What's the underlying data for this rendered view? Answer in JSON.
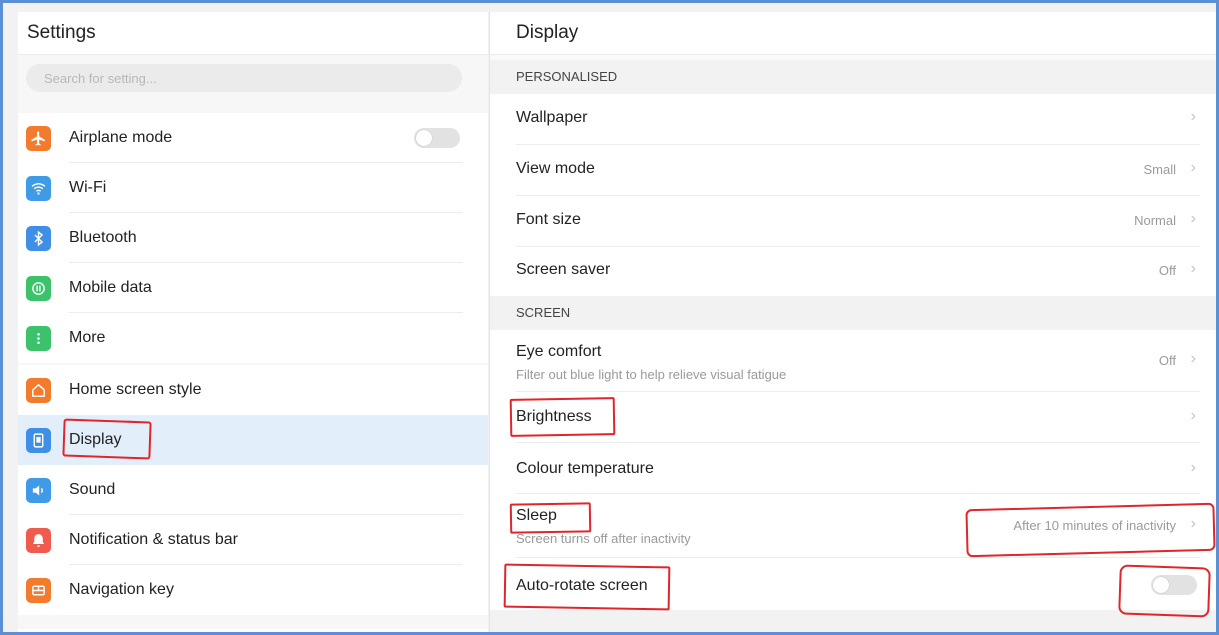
{
  "left_title": "Settings",
  "search_placeholder": "Search for setting...",
  "left_items": [
    {
      "label": "Airplane mode",
      "icon": "airplane-icon",
      "color": "#f27b2d"
    },
    {
      "label": "Wi-Fi",
      "icon": "wifi-icon",
      "color": "#3f9be6"
    },
    {
      "label": "Bluetooth",
      "icon": "bluetooth-icon",
      "color": "#3f8fe6"
    },
    {
      "label": "Mobile data",
      "icon": "mobile-data-icon",
      "color": "#3dc26c"
    },
    {
      "label": "More",
      "icon": "more-icon",
      "color": "#3dc26c"
    },
    {
      "label": "Home screen style",
      "icon": "home-icon",
      "color": "#f27b2d"
    },
    {
      "label": "Display",
      "icon": "display-icon",
      "color": "#3f8fe6"
    },
    {
      "label": "Sound",
      "icon": "sound-icon",
      "color": "#3f9be6"
    },
    {
      "label": "Notification & status bar",
      "icon": "notification-icon",
      "color": "#ef5b4f"
    },
    {
      "label": "Navigation key",
      "icon": "navigation-key-icon",
      "color": "#f27b2d"
    }
  ],
  "right_title": "Display",
  "sections": {
    "personalised": "PERSONALISED",
    "screen": "SCREEN"
  },
  "rows": {
    "wallpaper": {
      "label": "Wallpaper",
      "value": ""
    },
    "view_mode": {
      "label": "View mode",
      "value": "Small"
    },
    "font_size": {
      "label": "Font size",
      "value": "Normal"
    },
    "screen_saver": {
      "label": "Screen saver",
      "value": "Off"
    },
    "eye_comfort": {
      "label": "Eye comfort",
      "sub": "Filter out blue light to help relieve visual fatigue",
      "value": "Off"
    },
    "brightness": {
      "label": "Brightness",
      "value": ""
    },
    "colour_temperature": {
      "label": "Colour temperature",
      "value": ""
    },
    "sleep": {
      "label": "Sleep",
      "sub": "Screen turns off after inactivity",
      "value": "After 10 minutes of inactivity"
    },
    "auto_rotate": {
      "label": "Auto-rotate screen"
    }
  },
  "toggles": {
    "airplane_mode": false,
    "auto_rotate": false
  },
  "colors": {
    "accent": "#3f8fe6",
    "annotation": "#e0252b",
    "active_row": "#e3eefb",
    "frame": "#5b8fd6"
  }
}
